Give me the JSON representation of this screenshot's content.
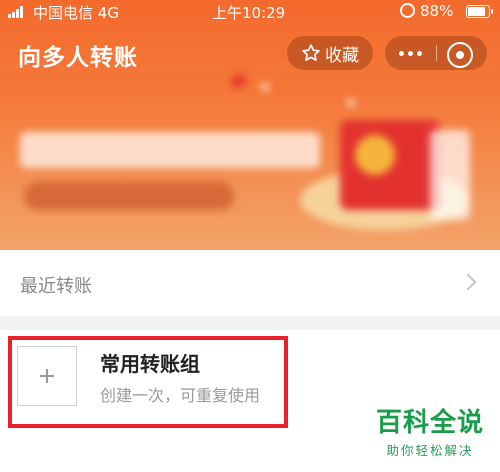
{
  "status_bar": {
    "carrier": "中国电信",
    "network": "4G",
    "time": "上午10:29",
    "battery": "88%"
  },
  "nav": {
    "title": "向多人转账",
    "favorite_label": "收藏"
  },
  "recent": {
    "label": "最近转账"
  },
  "group": {
    "title": "常用转账组",
    "subtitle": "创建一次，可重复使用"
  },
  "watermark": {
    "main": "百科全说",
    "sub": "助你轻松解决"
  },
  "colors": {
    "header_orange": "#f36a2c",
    "highlight_red": "#e8222b",
    "watermark_green": "#1a9d4a"
  }
}
